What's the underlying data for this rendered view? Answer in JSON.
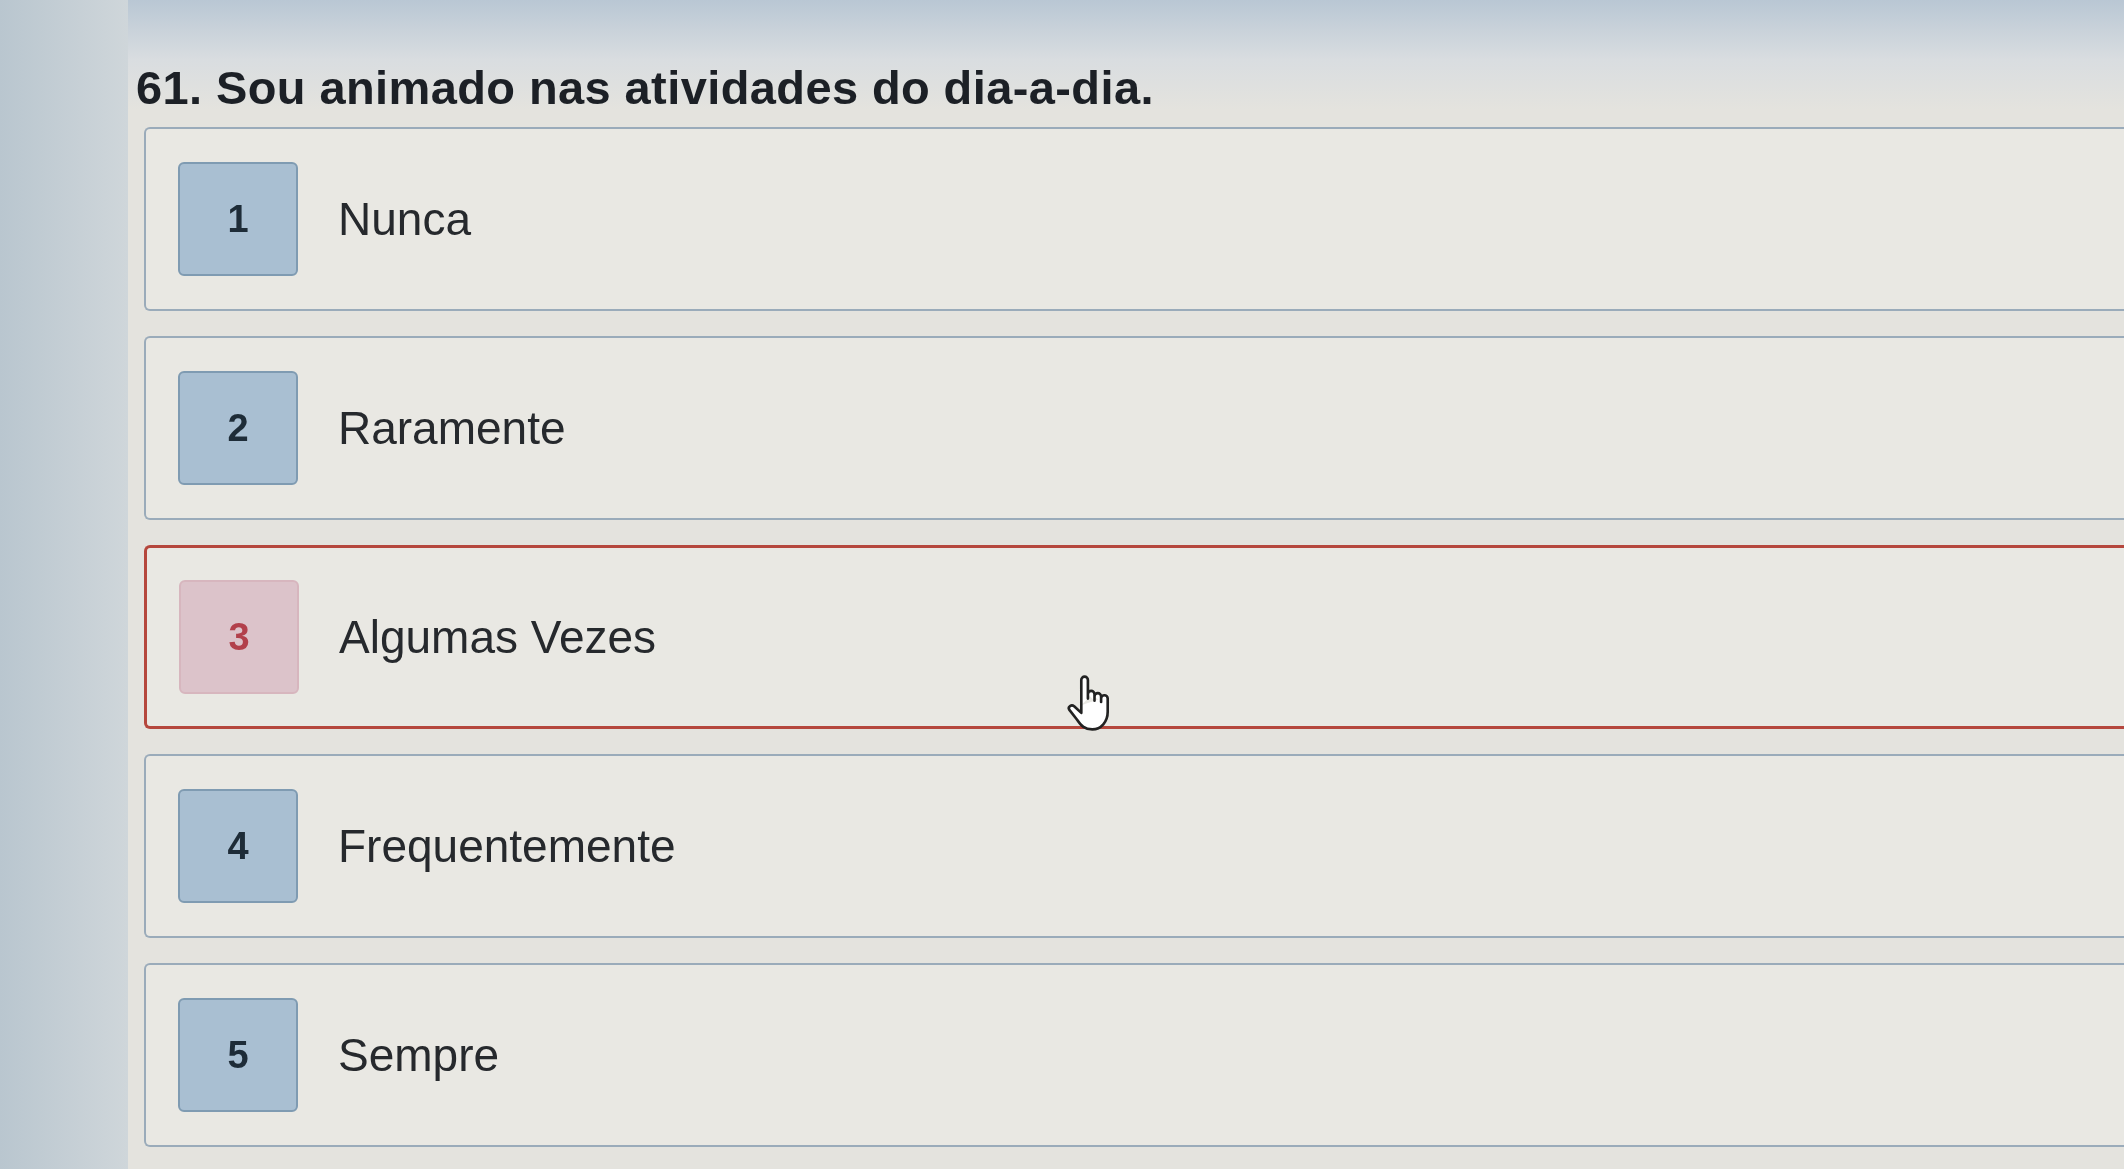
{
  "question": {
    "title": "61. Sou animado nas atividades do dia-a-dia."
  },
  "options": [
    {
      "number": "1",
      "label": "Nunca",
      "selected": false
    },
    {
      "number": "2",
      "label": "Raramente",
      "selected": false
    },
    {
      "number": "3",
      "label": "Algumas Vezes",
      "selected": true
    },
    {
      "number": "4",
      "label": "Frequentemente",
      "selected": false
    },
    {
      "number": "5",
      "label": "Sempre",
      "selected": false
    }
  ]
}
